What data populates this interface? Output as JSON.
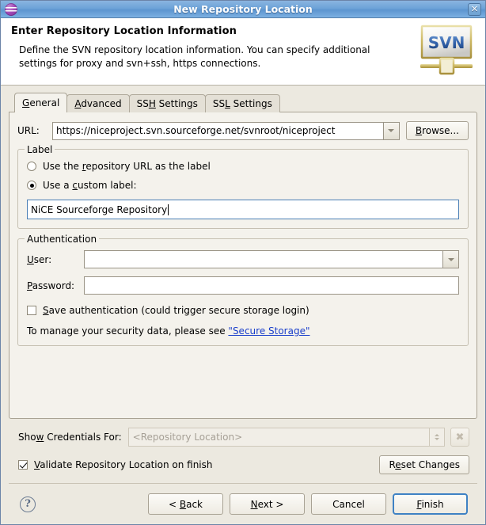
{
  "window": {
    "title": "New Repository Location",
    "icon": "svn-globe-icon",
    "close_label": "✕"
  },
  "header": {
    "title": "Enter Repository Location Information",
    "description": "Define the SVN repository location information. You can specify additional settings for proxy and svn+ssh, https connections.",
    "logo_text": "SVN"
  },
  "tabs": [
    {
      "label": "General",
      "mnemonic": "G",
      "active": true
    },
    {
      "label": "Advanced",
      "mnemonic": "A",
      "active": false
    },
    {
      "label": "SSH Settings",
      "mnemonic": "H",
      "active": false
    },
    {
      "label": "SSL Settings",
      "mnemonic": "L",
      "active": false
    }
  ],
  "general": {
    "url_label": "URL:",
    "url_value": "https://niceproject.svn.sourceforge.net/svnroot/niceproject",
    "browse_label": "Browse...",
    "label_group": {
      "title": "Label",
      "option_url": "Use the repository URL as the label",
      "option_custom": "Use a custom label:",
      "selected": "custom",
      "custom_value": "NiCE Sourceforge Repository"
    },
    "auth_group": {
      "title": "Authentication",
      "user_label": "User:",
      "user_value": "",
      "password_label": "Password:",
      "password_value": "",
      "save_auth_label": "Save authentication (could trigger secure storage login)",
      "save_auth_checked": false,
      "hint_prefix": "To manage your security data, please see ",
      "hint_link": "\"Secure Storage\""
    }
  },
  "bottom": {
    "credentials_label": "Show Credentials For:",
    "credentials_value": "<Repository Location>",
    "credentials_enabled": false,
    "clear_icon": "✖",
    "validate_label": "Validate Repository Location on finish",
    "validate_checked": true,
    "reset_label": "Reset Changes"
  },
  "footer": {
    "help_icon": "?",
    "back_label": "< Back",
    "next_label": "Next >",
    "cancel_label": "Cancel",
    "finish_label": "Finish"
  },
  "colors": {
    "title_bar": "#6da3d8",
    "dialog_bg": "#ece9e0",
    "panel_bg": "#f4f2ec",
    "link": "#1a3fcb",
    "focus_border": "#3f82c4",
    "svn_blue": "#2f5fa8"
  }
}
